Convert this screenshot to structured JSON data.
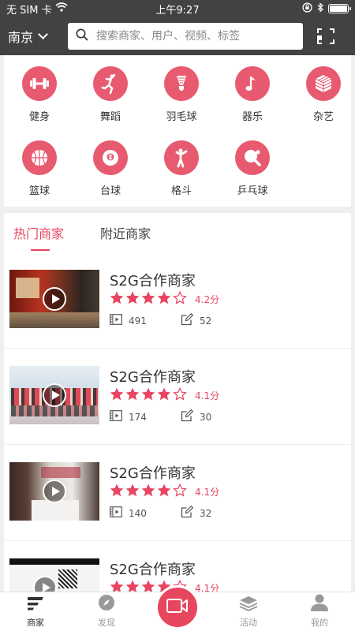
{
  "status_bar": {
    "carrier": "无 SIM 卡",
    "time": "上午9:27"
  },
  "header": {
    "city": "南京",
    "search_placeholder": "搜索商家、用户、视频、标签"
  },
  "categories": [
    {
      "label": "健身",
      "icon": "dumbbell-icon"
    },
    {
      "label": "舞蹈",
      "icon": "dancer-icon"
    },
    {
      "label": "羽毛球",
      "icon": "badminton-icon"
    },
    {
      "label": "器乐",
      "icon": "music-note-icon"
    },
    {
      "label": "杂艺",
      "icon": "cube-icon"
    },
    {
      "label": "篮球",
      "icon": "basketball-icon"
    },
    {
      "label": "台球",
      "icon": "billiard-ball-icon"
    },
    {
      "label": "格斗",
      "icon": "fighter-icon"
    },
    {
      "label": "乒乓球",
      "icon": "table-tennis-icon"
    }
  ],
  "tabs": {
    "hot": "热门商家",
    "nearby": "附近商家"
  },
  "merchants": [
    {
      "name": "S2G合作商家",
      "stars": 4,
      "rating_text": "4.2分",
      "videos": "491",
      "posts": "52"
    },
    {
      "name": "S2G合作商家",
      "stars": 4,
      "rating_text": "4.1分",
      "videos": "174",
      "posts": "30"
    },
    {
      "name": "S2G合作商家",
      "stars": 4,
      "rating_text": "4.1分",
      "videos": "140",
      "posts": "32"
    },
    {
      "name": "S2G合作商家",
      "stars": 4,
      "rating_text": "4.1分",
      "videos": "",
      "posts": ""
    }
  ],
  "bottom_nav": {
    "merchants": "商家",
    "discover": "发现",
    "activity": "活动",
    "mine": "我的"
  },
  "colors": {
    "accent": "#e8455f",
    "icon_circle": "#e85a6f",
    "header_bg": "#424242"
  }
}
